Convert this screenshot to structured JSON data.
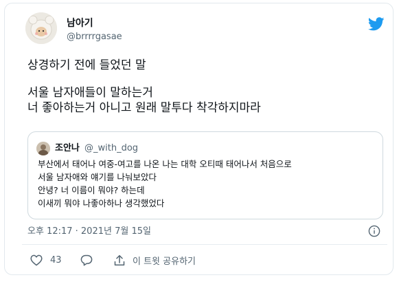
{
  "tweet": {
    "author": {
      "display_name": "남아기",
      "handle": "@brrrrgasae"
    },
    "text_lines": [
      "상경하기 전에 들었던 말",
      "서울 남자애들이 말하는거",
      "너 좋아하는거 아니고 원래 말투다 착각하지마라"
    ],
    "quoted": {
      "display_name": "조안나",
      "handle": "@_with_dog",
      "body_lines": [
        "부산에서 태어나 여중-여고를 나온 나는 대학 오티때 태어나서 처음으로",
        "서울 남자애와 얘기를 나눠보았다",
        "안녕? 너 이름이 뭐야? 하는데",
        "이새끼 뭐야 나좋아하나 생각했었다"
      ]
    },
    "timestamp": "오후 12:17 · 2021년 7월 15일",
    "actions": {
      "like_count": "43",
      "share_label": "이 트윗 공유하기"
    }
  },
  "colors": {
    "twitter_blue": "#1d9bf0",
    "secondary_text": "#536471",
    "border": "#cfd9de"
  },
  "icons": [
    "twitter-bird-icon",
    "info-icon",
    "heart-icon",
    "reply-icon",
    "share-icon"
  ]
}
